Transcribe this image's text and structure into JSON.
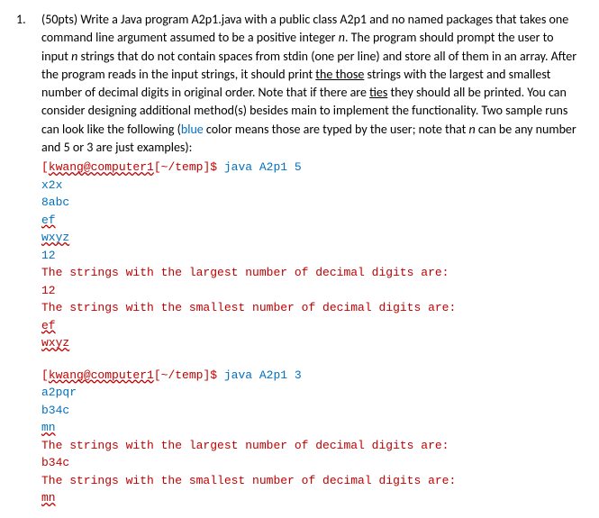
{
  "question": {
    "number": "1.",
    "points_prefix": "(50pts) ",
    "text_parts": {
      "p1a": "Write a Java program A2p1.java with a public class A2p1 and no named packages that takes one command line argument assumed to be a positive integer ",
      "p1_n1": "n",
      "p1b": ". The program should prompt the user to input ",
      "p1_n2": "n",
      "p1c": " strings that do not contain spaces from stdin (one per line) and store all of them in an array. After the program reads in the input strings, it should print ",
      "p1_underline1": "the those",
      "p1d": " strings with the largest and smallest number of decimal digits in original order. Note that if there are ",
      "p1_underline2": "ties",
      "p1e": " they should all be printed. You can consider designing additional method(s) besides main to implement the functionality. Two sample runs can look like the following (",
      "p1_blue": "blue",
      "p1f": " color means those are typed by the user; note that ",
      "p1_n3": "n",
      "p1g": " can be any number and 5 or 3 are just examples):"
    }
  },
  "run1": {
    "prompt_user": "kwang@computer1",
    "prompt_path": "[~/temp]$ ",
    "cmd": "java A2p1 5",
    "in1": "x2x",
    "in2": "8abc",
    "in3": "ef",
    "in4": "wxyz",
    "in5": "12",
    "out1": "The strings with the largest number of decimal digits are:",
    "out2": "12",
    "out3": "The strings with the smallest number of decimal digits are:",
    "out4": "ef",
    "out5": "wxyz"
  },
  "run2": {
    "prompt_user": "kwang@computer1",
    "prompt_path": "[~/temp]$ ",
    "cmd": "java A2p1 3",
    "in1": "a2pqr",
    "in2": "b34c",
    "in3": "mn",
    "out1": "The strings with the largest number of decimal digits are:",
    "out2": "b34c",
    "out3": "The strings with the smallest number of decimal digits are:",
    "out4": "mn"
  }
}
